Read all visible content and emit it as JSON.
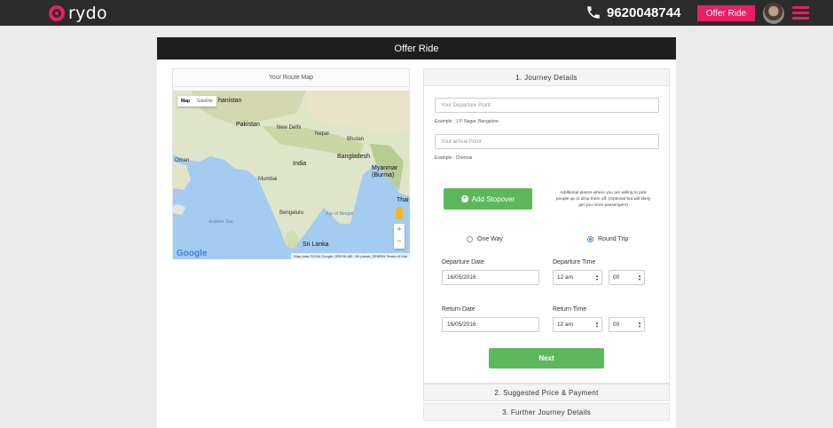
{
  "brand": {
    "name": "rydo",
    "accent": "#e91e63"
  },
  "topbar": {
    "phone_icon": "phone-icon",
    "phone": "9620048744",
    "offer_button": "Offer Ride",
    "avatar_icon": "user-avatar",
    "menu_icon": "hamburger-menu-icon"
  },
  "page": {
    "title": "Offer Ride"
  },
  "map_panel": {
    "title": "Your Route Map",
    "type_buttons": [
      "Map",
      "Satellite"
    ],
    "active_type": "Map",
    "labels": {
      "afghanistan": "hanistan",
      "pakistan": "Pakistan",
      "new_delhi": "New Delhi",
      "nepal": "Nepal",
      "bhutan": "Bhutan",
      "india": "India",
      "bangladesh": "Bangladesh",
      "myanmar": "Myanmar\n(Burma)",
      "thailand": "Thai",
      "oman": "Oman",
      "mumbai": "Mumbai",
      "bengaluru": "Bengaluru",
      "arabian_sea": "Arabian Sea",
      "bay_of_bengal": "Bay of Bengal",
      "sri_lanka": "Sri Lanka"
    },
    "zoom_in": "+",
    "zoom_out": "−",
    "attribution": "Map data ©2016 Google, ORION-ME, SK planet, ZENRIN   Terms of Use",
    "google_logo": "Google"
  },
  "journey": {
    "section_title": "1. Journey Details",
    "departure_placeholder": "Your Departure Point",
    "departure_example": "Example : J.P. Nagar, Bangalore",
    "arrival_placeholder": "Your arrival Point",
    "arrival_example": "Example : Chennai",
    "add_stopover": "Add Stopover",
    "stopover_note": "Additional places where you are willing to pick people up or drop them off. (Optional but will likely get you more passengers)",
    "trip_types": [
      {
        "label": "One Way",
        "selected": false
      },
      {
        "label": "Round Trip",
        "selected": true
      }
    ],
    "departure_date_label": "Departure Date",
    "departure_date": "16/05/2016",
    "departure_time_label": "Departure Time",
    "departure_hour": "12 am",
    "departure_minute": "00",
    "return_date_label": "Return Date",
    "return_date": "16/05/2016",
    "return_time_label": "Return Time",
    "return_hour": "12 am",
    "return_minute": "00",
    "next_button": "Next"
  },
  "sections": {
    "price": "2. Suggested Price & Payment",
    "further": "3. Further Journey Details"
  }
}
